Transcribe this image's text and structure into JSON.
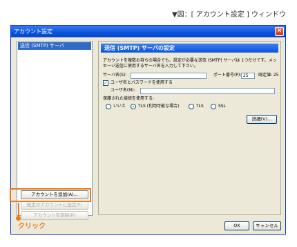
{
  "caption": "▼図：[ アカウント設定 ] ウィンドウ",
  "window": {
    "title": "アカウント設定",
    "close_glyph": "✕"
  },
  "sidebar": {
    "items": [
      {
        "label": "送信 (SMTP) サーバ",
        "selected": true
      }
    ],
    "buttons": {
      "add_account": "アカウントを追加(A)...",
      "set_default": "既定のアカウントに設定(F)",
      "delete_account": "アカウントを削除(R)"
    }
  },
  "annotation": {
    "click": "クリック",
    "color": "#e87a1e"
  },
  "panel": {
    "header": "送信 (SMTP) サーバの設定",
    "description": "アカウントを複数お持ちの場合でも、設定が必要な送信 (SMTP) サーバは 1つだけです。メッセージ送信に使用するサーバ名を入力して下さい。",
    "server_label": "サーバ名(S):",
    "server_value": "",
    "port_label": "ポート番号(P):",
    "port_value": "25",
    "default_label": "既定値: 25",
    "use_auth_label": "ユーザ名とパスワードを使用する",
    "use_auth_checked": true,
    "username_label": "ユーザ名(M):",
    "username_value": "",
    "secure_label": "保護された接続を使用する:",
    "radio_options": [
      {
        "label": "いいえ",
        "selected": false
      },
      {
        "label": "TLS (利用可能な場合)",
        "selected": true
      },
      {
        "label": "TLS",
        "selected": false
      },
      {
        "label": "SSL",
        "selected": false
      }
    ],
    "advanced_button": "詳細(V)..."
  },
  "footer": {
    "ok": "OK",
    "cancel": "キャンセル"
  },
  "colors": {
    "title_bar": "#0a53dc",
    "selection": "#316ac5",
    "window_bg": "#ece9d8"
  }
}
